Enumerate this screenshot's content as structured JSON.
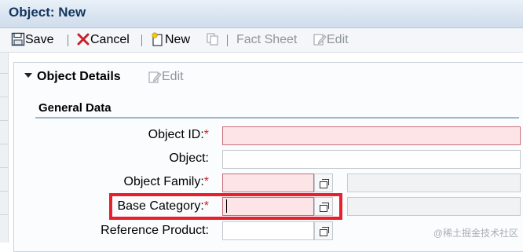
{
  "window": {
    "title": "Object: New"
  },
  "toolbar": {
    "save_label": "Save",
    "cancel_label": "Cancel",
    "new_label": "New",
    "fact_sheet_label": "Fact Sheet",
    "edit_label": "Edit"
  },
  "panel": {
    "title": "Object Details",
    "edit_label": "Edit"
  },
  "section": {
    "title": "General Data"
  },
  "fields": [
    {
      "label": "Object ID:",
      "required": "*",
      "value": ""
    },
    {
      "label": "Object:",
      "value": ""
    },
    {
      "label": "Object Family:",
      "required": "*",
      "value": ""
    },
    {
      "label": "Base Category:",
      "required": "*",
      "value": ""
    },
    {
      "label": "Reference Product:",
      "value": ""
    }
  ],
  "watermark": "@稀土掘金技术社区",
  "colors": {
    "required_bg": "#fde4e7",
    "highlight": "#e8202e",
    "title": "#12365e"
  },
  "icons": [
    "save-icon",
    "cancel-icon",
    "new-icon",
    "copy-icon",
    "edit-icon",
    "value-help-icon"
  ]
}
